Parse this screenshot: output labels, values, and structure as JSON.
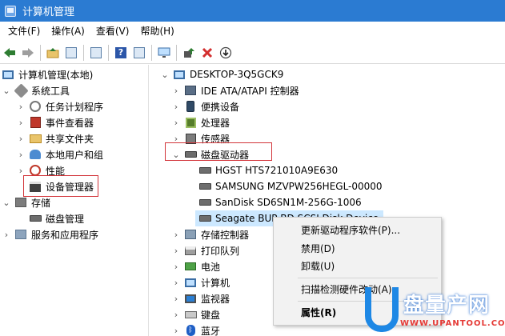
{
  "window": {
    "title": "计算机管理"
  },
  "menu": [
    "文件(F)",
    "操作(A)",
    "查看(V)",
    "帮助(H)"
  ],
  "toolbar": {
    "buttons": [
      "back-arrow-icon",
      "forward-arrow-icon",
      "up-folder-icon",
      "show-pane-icon",
      "properties-icon",
      "help-icon",
      "action-pane-icon",
      "monitor-icon",
      "update-driver-icon",
      "uninstall-icon",
      "disable-icon"
    ]
  },
  "left_tree": {
    "root": "计算机管理(本地)",
    "system_tools": "系统工具",
    "task_scheduler": "任务计划程序",
    "event_viewer": "事件查看器",
    "shared_folders": "共享文件夹",
    "local_users": "本地用户和组",
    "performance": "性能",
    "device_manager": "设备管理器",
    "storage": "存储",
    "disk_management": "磁盘管理",
    "services": "服务和应用程序"
  },
  "device_tree": {
    "computer": "DESKTOP-3Q5GCK9",
    "ide": "IDE ATA/ATAPI 控制器",
    "portable": "便携设备",
    "processors": "处理器",
    "sensors": "传感器",
    "disk_drives": "磁盘驱动器",
    "disks": [
      "HGST HTS721010A9E630",
      "SAMSUNG MZVPW256HEGL-00000",
      "SanDisk SD6SN1M-256G-1006",
      "Seagate BUP BD SCSI Disk Device"
    ],
    "storage_controllers": "存储控制器",
    "print_queues": "打印队列",
    "battery": "电池",
    "computer_cat": "计算机",
    "monitors": "监视器",
    "keyboards": "键盘",
    "bluetooth": "蓝牙"
  },
  "context_menu": {
    "update_driver": "更新驱动程序软件(P)...",
    "disable": "禁用(D)",
    "uninstall": "卸载(U)",
    "scan": "扫描检测硬件改动(A)",
    "properties": "属性(R)"
  },
  "watermark": {
    "brand": "盘量产网",
    "url": "WWW.UPANTOOL.COM"
  },
  "colors": {
    "titlebar": "#2b7bd2",
    "selection": "#cce8ff",
    "highlight_box": "#d2353a"
  }
}
